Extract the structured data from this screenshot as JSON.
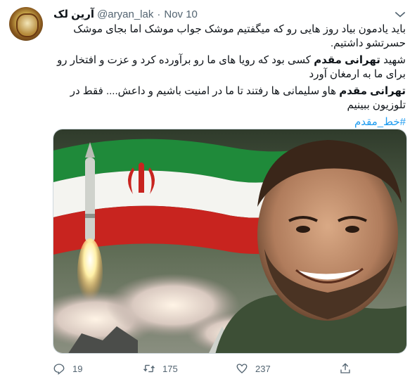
{
  "tweet": {
    "display_name": "آرین لک",
    "handle": "@aryan_lak",
    "separator": "·",
    "date": "Nov 10",
    "lines": [
      "باید یادمون بیاد روز هایی رو که میگفتیم موشک جواب موشک اما بجای موشک",
      "حسرتشو داشتیم.",
      "کسی بود که رویا های ما رو برآورده کرد و عزت و افتخار رو",
      "برای ما به ارمغان آورد",
      "هاو سلیمانی ها رفتند تا ما در امنیت باشیم و داعش.... فقط در",
      "تلوزیون ببینیم"
    ],
    "prefix_shahid": "شهید",
    "bold_name": "تهرانی مقدم",
    "hashtag": "#خط_مقدم",
    "replies": "19",
    "retweets": "175",
    "likes": "237",
    "colors": {
      "accent": "#1d9bf0",
      "muted": "#536471",
      "text": "#0f1419"
    },
    "icons": [
      "more-icon",
      "reply-icon",
      "retweet-icon",
      "like-icon",
      "share-icon"
    ]
  }
}
